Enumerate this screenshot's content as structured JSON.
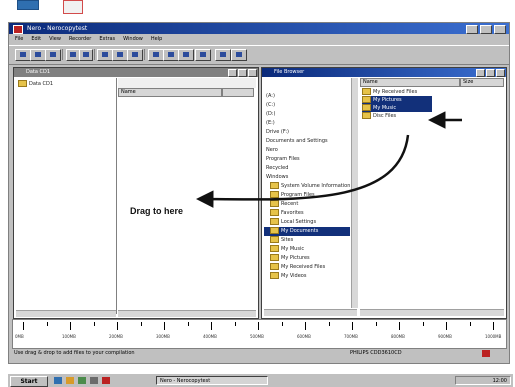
{
  "window": {
    "title": "Nero - Nerocopytest",
    "menu": [
      "File",
      "Edit",
      "View",
      "Recorder",
      "Extras",
      "Window",
      "Help"
    ]
  },
  "compilation_pane": {
    "title": "Data CD1",
    "tree_item": "Data CD1",
    "column_header": "Name"
  },
  "browser_pane": {
    "title": "File Browser",
    "tree_items": [
      "(A:)",
      "(C:)",
      "(D:)",
      "(E:)",
      "Drive (F:)",
      "Documents and Settings",
      "Nero",
      "Program Files",
      "Recycled",
      "Windows",
      "System Volume Information",
      "Program Files",
      "Recent",
      "Favorites",
      "Local Settings",
      "My Documents",
      "Sites",
      "My Music",
      "My Pictures",
      "My Received Files",
      "My Videos"
    ],
    "selected_tree_index": 15,
    "column_header": "Name",
    "column_header_right": "Size",
    "files": [
      "My Received Files",
      "My Pictures",
      "My Music",
      "Disc Files"
    ],
    "selected_file_indexes": [
      1,
      2
    ]
  },
  "ruler": {
    "labels": [
      "0MB",
      "100MB",
      "200MB",
      "300MB",
      "400MB",
      "500MB",
      "600MB",
      "700MB",
      "800MB",
      "900MB",
      "1000MB"
    ]
  },
  "status": {
    "left": "Use drag & drop to add files to your compilation",
    "right": "PHILIPS CDD3610CD"
  },
  "annotation": {
    "label": "Drag to here"
  },
  "taskbar": {
    "start": "Start",
    "task": "Nero - Nerocopytest",
    "time": "12:00"
  }
}
